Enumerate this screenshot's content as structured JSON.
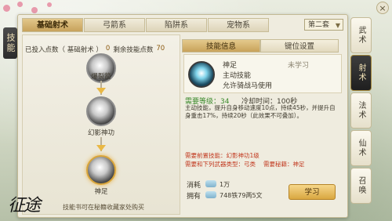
{
  "left_tab": "技能",
  "category_tabs": [
    "基础射术",
    "弓箭系",
    "陷阱系",
    "宠物系"
  ],
  "dropdown": {
    "selected": "第二套"
  },
  "points": {
    "spent_label": "已投入点数（ 基础射术 ）",
    "spent_value": "0",
    "remaining_label": "剩余技能点数",
    "remaining_value": "70"
  },
  "tree_nodes": [
    {
      "label": "爆裂箭"
    },
    {
      "label": "幻影神功"
    },
    {
      "label": "神足"
    }
  ],
  "footer_note": "技能书可在秘籍收藏家处购买",
  "sub_tabs": [
    "技能信息",
    "键位设置"
  ],
  "skill": {
    "name": "神足",
    "status": "未学习",
    "type": "主动技能",
    "use": "允许骑战马使用",
    "level_label": "需要等级：",
    "level_value": "34",
    "cooldown_label": "冷却时间：",
    "cooldown_value": "100秒",
    "description": "主动技能，提升自身移动速度10点，持续45秒，并提升自身重击17%，持续20秒（此效果不可叠加）。",
    "req_skill_label": "需要前置技能：",
    "req_skill_value": "幻影神功1级",
    "req_weapon_label": "需要和下列武器类型：",
    "req_weapon_value": "弓类",
    "req_book_label": "需要秘籍：",
    "req_book_value": "神足"
  },
  "cost": {
    "consume_label": "消耗",
    "consume_value": "1万",
    "own_label": "拥有",
    "own_value": "748铁79两5文"
  },
  "learn_button": "学习",
  "right_menu": [
    "武术",
    "射术",
    "法术",
    "仙术",
    "召唤"
  ],
  "right_menu_active": "射术",
  "close_glyph": "×",
  "logo_text": "征途"
}
